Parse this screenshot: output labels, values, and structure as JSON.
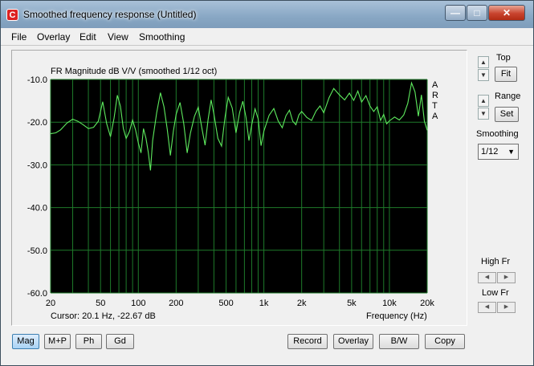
{
  "window": {
    "title": "Smoothed frequency response (Untitled)",
    "app_icon": "C"
  },
  "menu": [
    "File",
    "Overlay",
    "Edit",
    "View",
    "Smoothing"
  ],
  "plot": {
    "title": "FR Magnitude dB V/V (smoothed 1/12 oct)",
    "side_text": [
      "A",
      "R",
      "T",
      "A"
    ],
    "xlabel": "Frequency (Hz)",
    "cursor": "Cursor: 20.1 Hz, -22.67 dB"
  },
  "chart_data": {
    "type": "line",
    "x_scale": "log",
    "xlim": [
      20,
      20000
    ],
    "ylim": [
      -60,
      -10
    ],
    "x_ticks": [
      20,
      50,
      100,
      200,
      500,
      1000,
      2000,
      5000,
      10000,
      20000
    ],
    "x_tick_labels": [
      "20",
      "50",
      "100",
      "200",
      "500",
      "1k",
      "2k",
      "5k",
      "10k",
      "20k"
    ],
    "y_ticks": [
      -10,
      -20,
      -30,
      -40,
      -50,
      -60
    ],
    "y_tick_labels": [
      "-10.0",
      "-20.0",
      "-30.0",
      "-40.0",
      "-50.0",
      "-60.0"
    ],
    "grid": true,
    "background": "#000000",
    "grid_color": "#1e7a2a",
    "line_color": "#5eea5e",
    "series": [
      {
        "x": [
          20,
          22,
          24,
          27,
          30,
          33,
          36,
          40,
          44,
          48,
          52,
          56,
          60,
          64,
          68,
          72,
          76,
          80,
          85,
          90,
          95,
          100,
          105,
          110,
          115,
          120,
          125,
          130,
          140,
          150,
          160,
          170,
          180,
          190,
          200,
          215,
          230,
          245,
          260,
          280,
          300,
          320,
          340,
          360,
          380,
          400,
          430,
          460,
          490,
          520,
          560,
          600,
          640,
          680,
          720,
          760,
          800,
          850,
          900,
          950,
          1000,
          1100,
          1200,
          1300,
          1400,
          1500,
          1600,
          1700,
          1800,
          1900,
          2000,
          2200,
          2400,
          2600,
          2800,
          3000,
          3300,
          3600,
          4000,
          4400,
          4800,
          5200,
          5600,
          6000,
          6500,
          7000,
          7500,
          8000,
          8500,
          9000,
          9500,
          10000,
          11000,
          12000,
          13000,
          14000,
          15000,
          16000,
          17000,
          18000,
          19000,
          20000
        ],
        "y": [
          -22.7,
          -22.5,
          -21.8,
          -20.2,
          -19.3,
          -19.8,
          -20.5,
          -21.5,
          -21.2,
          -19.8,
          -15.2,
          -20.4,
          -23.4,
          -19.1,
          -13.7,
          -16.3,
          -21.5,
          -23.8,
          -22.2,
          -19.5,
          -21.8,
          -24.9,
          -27.2,
          -21.5,
          -23.8,
          -27.1,
          -31.3,
          -24.3,
          -17.8,
          -13.1,
          -16.4,
          -21.7,
          -27.8,
          -22.1,
          -18.2,
          -15.4,
          -20.3,
          -27.2,
          -22.6,
          -18.6,
          -16.5,
          -21.2,
          -25.4,
          -19.3,
          -14.8,
          -18.1,
          -23.8,
          -25.6,
          -18.9,
          -14.2,
          -16.7,
          -22.5,
          -17.8,
          -15.1,
          -18.8,
          -24.3,
          -20.6,
          -16.9,
          -19.2,
          -25.5,
          -22.1,
          -18.4,
          -16.8,
          -19.7,
          -21.3,
          -18.5,
          -17.2,
          -19.8,
          -20.6,
          -18.3,
          -17.5,
          -18.9,
          -19.6,
          -17.4,
          -16.2,
          -17.8,
          -14.3,
          -12.1,
          -13.6,
          -14.8,
          -13.2,
          -14.9,
          -12.7,
          -15.3,
          -13.8,
          -16.2,
          -17.5,
          -16.4,
          -19.6,
          -18.2,
          -20.4,
          -19.7,
          -18.8,
          -19.5,
          -18.3,
          -15.6,
          -10.8,
          -12.9,
          -18.6,
          -13.6,
          -19.8,
          -21.9
        ]
      }
    ]
  },
  "side": {
    "top_label": "Top",
    "fit": "Fit",
    "range_label": "Range",
    "set": "Set",
    "smoothing_label": "Smoothing",
    "smoothing_value": "1/12",
    "high_fr": "High Fr",
    "low_fr": "Low Fr"
  },
  "bottom": {
    "mag": "Mag",
    "mp": "M+P",
    "ph": "Ph",
    "gd": "Gd",
    "record": "Record",
    "overlay": "Overlay",
    "bw": "B/W",
    "copy": "Copy"
  },
  "icons": [
    "app-icon",
    "minimize-icon",
    "maximize-icon",
    "close-icon",
    "spin-up-icon",
    "spin-down-icon",
    "arrow-left-icon",
    "arrow-right-icon",
    "dropdown-arrow-icon"
  ]
}
